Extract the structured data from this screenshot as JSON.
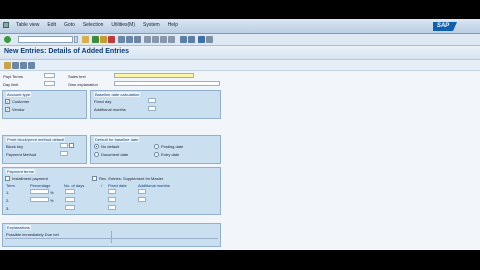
{
  "menu": [
    "Table view",
    "Edit",
    "Goto",
    "Selection",
    "Utilities(M)",
    "System",
    "Help"
  ],
  "logo": "SAP",
  "window_title": "New Entries: Details of Added Entries",
  "fields": {
    "payt_terms_label": "Payt Terms",
    "day_limit_label": "Day limit",
    "sales_text_label": "Sales text",
    "own_explanation_label": "Own explanation"
  },
  "account_type": {
    "title": "Account type",
    "customer": "Customer",
    "vendor": "Vendor",
    "customer_checked": true,
    "vendor_checked": true
  },
  "baseline_calc": {
    "title": "Baseline date calculation",
    "fixed_day": "Fixed day",
    "additional_months": "Additional months"
  },
  "pmnt_block": {
    "title": "Pmnt block/pmnt method default",
    "block_key": "Block key",
    "payment_method": "Payment Method"
  },
  "default_baseline": {
    "title": "Default for baseline date",
    "no_default": "No default",
    "posting_date": "Posting date",
    "document_date": "Document date",
    "entry_date": "Entry date",
    "selected": "no_default"
  },
  "payment_terms": {
    "title": "Payment terms",
    "installment": "Installment payment",
    "rec_entries": "Rec. Entries: Supplement fm Master",
    "headers": [
      "Term",
      "Percentage",
      "No. of days",
      "/",
      "Fixed date",
      "Additional months"
    ],
    "rows": [
      "1.",
      "2.",
      "3."
    ],
    "pct_symbol": "%"
  },
  "explanations": {
    "title": "Explanations",
    "possible_due": "Possible immediately Due net"
  }
}
